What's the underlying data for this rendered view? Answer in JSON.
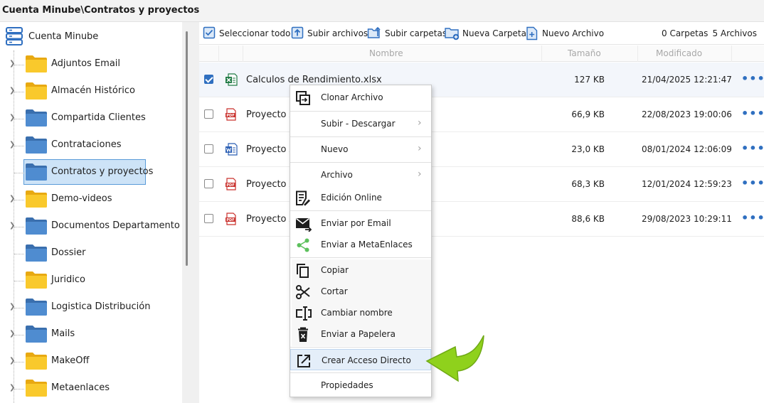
{
  "window": {
    "title": "Cuenta Minube\\Contratos y proyectos"
  },
  "sidebar": {
    "root_label": "Cuenta Minube",
    "items": [
      {
        "label": "Adjuntos Email",
        "color": "yellow",
        "expandable": true
      },
      {
        "label": "Almacén Histórico",
        "color": "yellow",
        "expandable": true
      },
      {
        "label": "Compartida Clientes",
        "color": "blue",
        "expandable": true
      },
      {
        "label": "Contrataciones",
        "color": "blue",
        "expandable": true
      },
      {
        "label": "Contratos y proyectos",
        "color": "blue",
        "expandable": false,
        "selected": true
      },
      {
        "label": "Demo-videos",
        "color": "yellow",
        "expandable": true
      },
      {
        "label": "Documentos Departamento",
        "color": "blue",
        "expandable": true
      },
      {
        "label": "Dossier",
        "color": "blue",
        "expandable": false
      },
      {
        "label": "Juridico",
        "color": "yellow",
        "expandable": false
      },
      {
        "label": "Logistica Distribución",
        "color": "blue",
        "expandable": true
      },
      {
        "label": "Mails",
        "color": "blue",
        "expandable": true
      },
      {
        "label": "MakeOff",
        "color": "yellow",
        "expandable": true
      },
      {
        "label": "Metaenlaces",
        "color": "yellow",
        "expandable": true
      }
    ]
  },
  "toolbar": {
    "select_all": "Seleccionar todo",
    "upload_files": "Subir archivos",
    "upload_folders": "Subir carpetas",
    "new_folder": "Nueva Carpeta",
    "new_file": "Nuevo Archivo",
    "folder_count": "0 Carpetas",
    "file_count": "5 Archivos"
  },
  "table": {
    "headers": {
      "name": "Nombre",
      "size": "Tamaño",
      "modified": "Modificado"
    },
    "rows": [
      {
        "name": "Calculos de Rendimiento.xlsx",
        "type": "xlsx",
        "size": "127 KB",
        "modified": "21/04/2025 12:21:47",
        "selected": true
      },
      {
        "name": "Proyecto A",
        "type": "pdf",
        "size": "66,9 KB",
        "modified": "22/08/2023 19:00:06",
        "selected": false
      },
      {
        "name": "Proyecto A",
        "type": "docx",
        "size": "23,0 KB",
        "modified": "08/01/2024 12:06:09",
        "selected": false
      },
      {
        "name": "Proyecto A",
        "type": "pdf",
        "size": "68,3 KB",
        "modified": "12/01/2024 12:59:23",
        "selected": false
      },
      {
        "name": "Proyecto A",
        "type": "pdf",
        "size": "88,6 KB",
        "modified": "29/08/2023 10:29:11",
        "selected": false
      }
    ],
    "more_glyph": "•••"
  },
  "context_menu": {
    "clone": "Clonar Archivo",
    "upload_download": "Subir - Descargar",
    "new": "Nuevo",
    "file": "Archivo",
    "edit_online": "Edición Online",
    "send_email": "Enviar por Email",
    "send_metalinks": "Enviar a MetaEnlaces",
    "copy": "Copiar",
    "cut": "Cortar",
    "rename": "Cambiar nombre",
    "trash": "Enviar a Papelera",
    "shortcut": "Crear Acceso Directo",
    "properties": "Propiedades",
    "submenu_glyph": "›"
  },
  "colors": {
    "accent": "#2f6fc0",
    "folder_yellow": "#f7c325",
    "folder_blue": "#4a86c8",
    "highlight_arrow": "#8fd11c",
    "selection_bg": "#cde3f7"
  }
}
